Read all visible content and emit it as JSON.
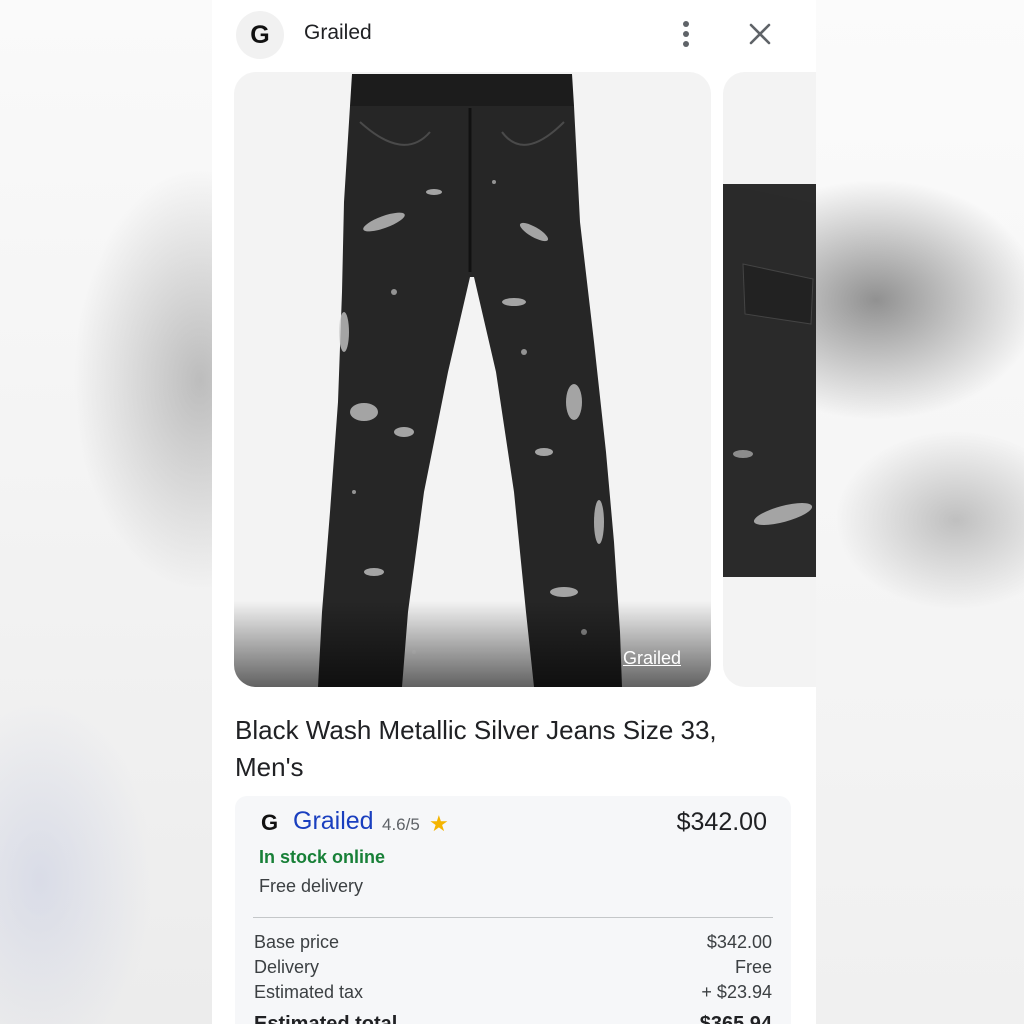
{
  "header": {
    "logo_letter": "G",
    "site_name": "Grailed"
  },
  "image": {
    "source_label": "Grailed",
    "subject": "black distressed metallic silver jeans"
  },
  "product": {
    "title": "Black Wash Metallic Silver Jeans Size 33, Men's"
  },
  "offer": {
    "logo_letter": "G",
    "seller": "Grailed",
    "rating": "4.6/5",
    "star": "★",
    "price": "$342.00",
    "stock": "In stock online",
    "delivery_note": "Free delivery",
    "breakdown": [
      {
        "label": "Base price",
        "value": "$342.00"
      },
      {
        "label": "Delivery",
        "value": "Free"
      },
      {
        "label": "Estimated tax",
        "value": "+ $23.94"
      },
      {
        "label": "Estimated total",
        "value": "$365.94"
      }
    ]
  },
  "colors": {
    "seller_link": "#1a3fbf",
    "stock_green": "#188038",
    "star": "#f4b400"
  },
  "icons": {
    "more": "more-vert-icon",
    "close": "close-icon"
  }
}
